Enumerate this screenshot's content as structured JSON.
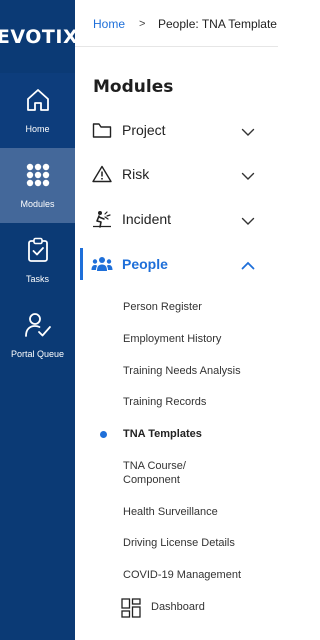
{
  "brand": {
    "logo_text": "EVOTIX"
  },
  "rail": {
    "items": [
      {
        "label": "Home",
        "icon": "home-icon"
      },
      {
        "label": "Modules",
        "icon": "grid-dots-icon"
      },
      {
        "label": "Tasks",
        "icon": "clipboard-check-icon"
      },
      {
        "label": "Portal Queue",
        "icon": "user-check-icon"
      }
    ],
    "active": "Modules",
    "colors": {
      "background": "#0b3a75",
      "active_background": "#44689a"
    }
  },
  "breadcrumb": {
    "home": "Home",
    "separator": ">",
    "current": "People: TNA Template"
  },
  "panel": {
    "title": "Modules",
    "modules": [
      {
        "label": "Project",
        "icon": "folder-icon",
        "expanded": false
      },
      {
        "label": "Risk",
        "icon": "warning-icon",
        "expanded": false
      },
      {
        "label": "Incident",
        "icon": "incident-icon",
        "expanded": false
      },
      {
        "label": "People",
        "icon": "people-icon",
        "expanded": true
      }
    ],
    "submenu": [
      "Person Register",
      "Employment History",
      "Training Needs Analysis",
      "Training Records",
      "TNA Templates",
      "TNA Course/ Component",
      "Health Surveillance",
      "Driving License Details",
      "COVID-19 Management"
    ],
    "selected_sub": "TNA Templates",
    "dashboard": "Dashboard"
  },
  "colors": {
    "accent": "#1e6fd9"
  }
}
